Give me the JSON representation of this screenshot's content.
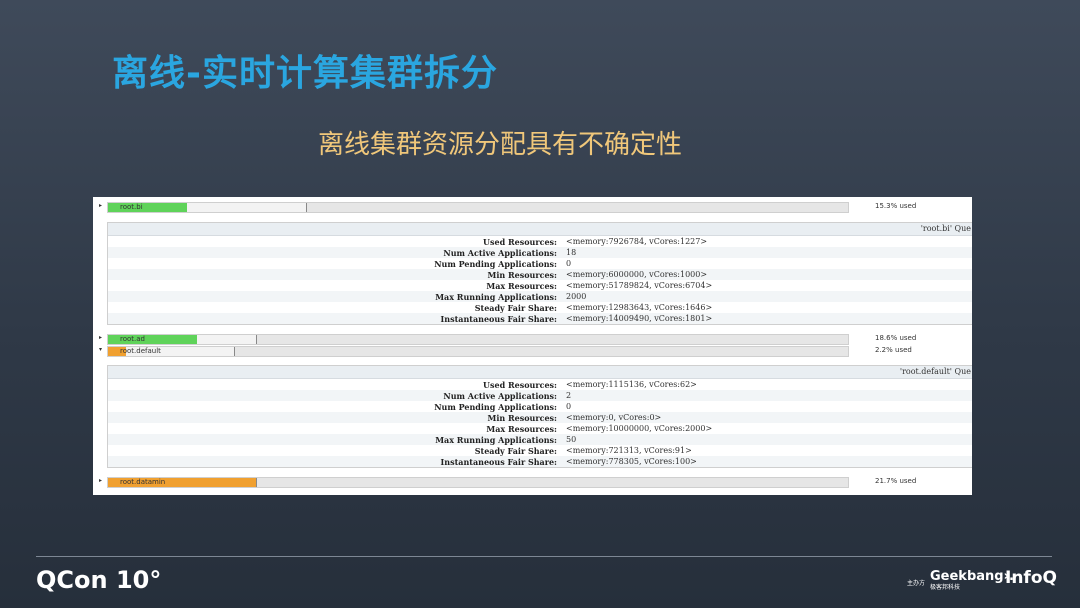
{
  "slide": {
    "title": "离线-实时计算集群拆分",
    "subtitle": "离线集群资源分配具有不确定性"
  },
  "queues": [
    {
      "name": "root.bi",
      "used": "15.3% used",
      "fill_fraction": 0.4,
      "inner_fraction": 0.93,
      "color": "#5fd35a",
      "bar_fraction": 0.268
    },
    {
      "name": "root.ad",
      "used": "18.6% used",
      "fill_fraction": 0.6,
      "inner_fraction": 0.9,
      "color": "#5fd35a",
      "bar_fraction": 0.2
    },
    {
      "name": "root.default",
      "used": "2.2% used",
      "fill_fraction": 0.14,
      "inner_fraction": 0.14,
      "color": "#f0a030",
      "bar_fraction": 0.17
    },
    {
      "name": "root.datamin",
      "used": "21.7% used",
      "fill_fraction": 1.0,
      "inner_fraction": 0.64,
      "color": "#f0a030",
      "bar_fraction": 0.2
    }
  ],
  "queue_details": [
    {
      "header": "'root.bi' Que",
      "rows": [
        {
          "key": "Used Resources:",
          "value": "<memory:7926784, vCores:1227>"
        },
        {
          "key": "Num Active Applications:",
          "value": "18"
        },
        {
          "key": "Num Pending Applications:",
          "value": "0"
        },
        {
          "key": "Min Resources:",
          "value": "<memory:6000000, vCores:1000>"
        },
        {
          "key": "Max Resources:",
          "value": "<memory:51789824, vCores:6704>"
        },
        {
          "key": "Max Running Applications:",
          "value": "2000"
        },
        {
          "key": "Steady Fair Share:",
          "value": "<memory:12983643, vCores:1646>"
        },
        {
          "key": "Instantaneous Fair Share:",
          "value": "<memory:14009490, vCores:1801>"
        }
      ]
    },
    {
      "header": "'root.default' Que",
      "rows": [
        {
          "key": "Used Resources:",
          "value": "<memory:1115136, vCores:62>"
        },
        {
          "key": "Num Active Applications:",
          "value": "2"
        },
        {
          "key": "Num Pending Applications:",
          "value": "0"
        },
        {
          "key": "Min Resources:",
          "value": "<memory:0, vCores:0>"
        },
        {
          "key": "Max Resources:",
          "value": "<memory:10000000, vCores:2000>"
        },
        {
          "key": "Max Running Applications:",
          "value": "50"
        },
        {
          "key": "Steady Fair Share:",
          "value": "<memory:721313, vCores:91>"
        },
        {
          "key": "Instantaneous Fair Share:",
          "value": "<memory:778305, vCores:100>"
        }
      ]
    }
  ],
  "footer": {
    "left_logo": "QCon 10°",
    "host_label": "主办方",
    "geekbang": "Geekbang›.",
    "geekbang_cn": "极客邦科技",
    "infoq": "InfoQ"
  }
}
